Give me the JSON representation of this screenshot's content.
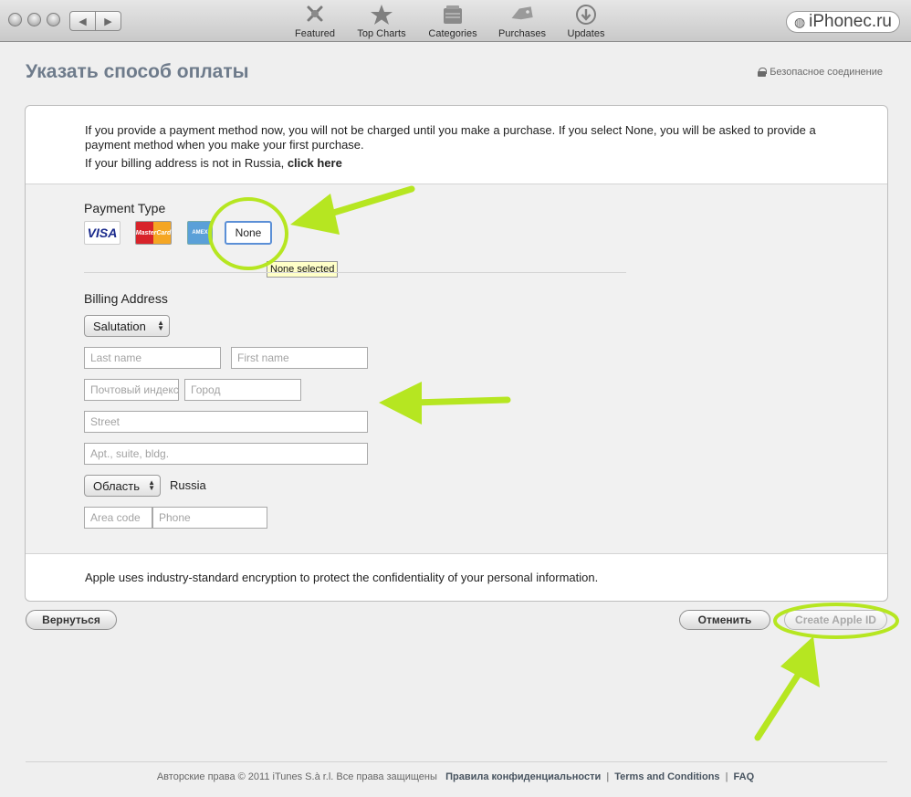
{
  "toolbar": {
    "tabs": [
      {
        "label": "Featured",
        "icon": "featured-icon"
      },
      {
        "label": "Top Charts",
        "icon": "star-icon"
      },
      {
        "label": "Categories",
        "icon": "categories-icon"
      },
      {
        "label": "Purchases",
        "icon": "tag-icon"
      },
      {
        "label": "Updates",
        "icon": "download-icon"
      }
    ],
    "back_glyph": "◀",
    "forward_glyph": "▶",
    "brand": "iPhonec.ru"
  },
  "header": {
    "title": "Указать способ оплаты",
    "secure_label": "Безопасное соединение"
  },
  "intro": {
    "line1": "If you provide a payment method now, you will not be charged until you make a purchase. If you select None, you will be asked to provide a payment method when you make your first purchase.",
    "line2_prefix": "If your billing address is not in Russia, ",
    "line2_link": "click here"
  },
  "payment": {
    "label": "Payment Type",
    "cards": [
      "VISA",
      "MasterCard",
      "AMEX"
    ],
    "none_label": "None",
    "tooltip": "None selected"
  },
  "billing": {
    "label": "Billing Address",
    "salutation": "Salutation",
    "last_name_placeholder": "Last name",
    "first_name_placeholder": "First name",
    "postal_placeholder": "Почтовый индекс",
    "city_placeholder": "Город",
    "street_placeholder": "Street",
    "apt_placeholder": "Apt., suite, bldg.",
    "region": "Область",
    "country": "Russia",
    "area_code_placeholder": "Area code",
    "phone_placeholder": "Phone"
  },
  "footer_note": "Apple uses industry-standard encryption to protect the confidentiality of your personal information.",
  "buttons": {
    "back": "Вернуться",
    "cancel": "Отменить",
    "create": "Create Apple ID"
  },
  "footer": {
    "copyright": "Авторские права © 2011 iTunes S.à r.l. Все права защищены",
    "privacy": "Правила конфиденциальности",
    "terms": "Terms and Conditions",
    "faq": "FAQ",
    "separator": "|"
  },
  "colors": {
    "annotation": "#b6e621",
    "title": "#6e7b8b",
    "focus_blue": "#5b8fd6"
  }
}
